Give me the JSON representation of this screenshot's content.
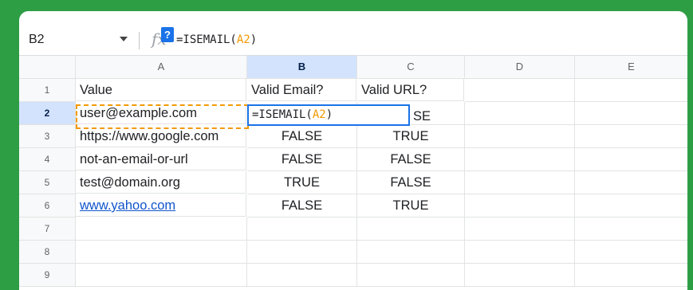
{
  "formula_bar": {
    "name_box": "B2",
    "fx_symbol": "fx",
    "help_badge": "?",
    "formula_prefix": "=ISEMAIL(",
    "formula_ref": "A2",
    "formula_suffix": ")"
  },
  "columns": [
    "A",
    "B",
    "C",
    "D",
    "E"
  ],
  "rows": [
    {
      "num": "1",
      "a": "Value",
      "b": "Valid Email?",
      "c": "Valid URL?"
    },
    {
      "num": "2",
      "a": "user@example.com",
      "b": "",
      "c": "SE"
    },
    {
      "num": "3",
      "a": "https://www.google.com",
      "b": "FALSE",
      "c": "TRUE"
    },
    {
      "num": "4",
      "a": "not-an-email-or-url",
      "b": "FALSE",
      "c": "FALSE"
    },
    {
      "num": "5",
      "a": "test@domain.org",
      "b": "TRUE",
      "c": "FALSE"
    },
    {
      "num": "6",
      "a": "www.yahoo.com",
      "b": "FALSE",
      "c": "TRUE"
    },
    {
      "num": "7",
      "a": "",
      "b": "",
      "c": ""
    },
    {
      "num": "8",
      "a": "",
      "b": "",
      "c": ""
    },
    {
      "num": "9",
      "a": "",
      "b": "",
      "c": ""
    }
  ],
  "editor": {
    "prefix": "=ISEMAIL(",
    "ref": "A2",
    "suffix": ")"
  },
  "colors": {
    "frame_green": "#2e9e45",
    "active_header": "#d3e3fd",
    "selection_blue": "#1a73e8",
    "reference_orange": "#f29900",
    "link_blue": "#1155cc"
  }
}
